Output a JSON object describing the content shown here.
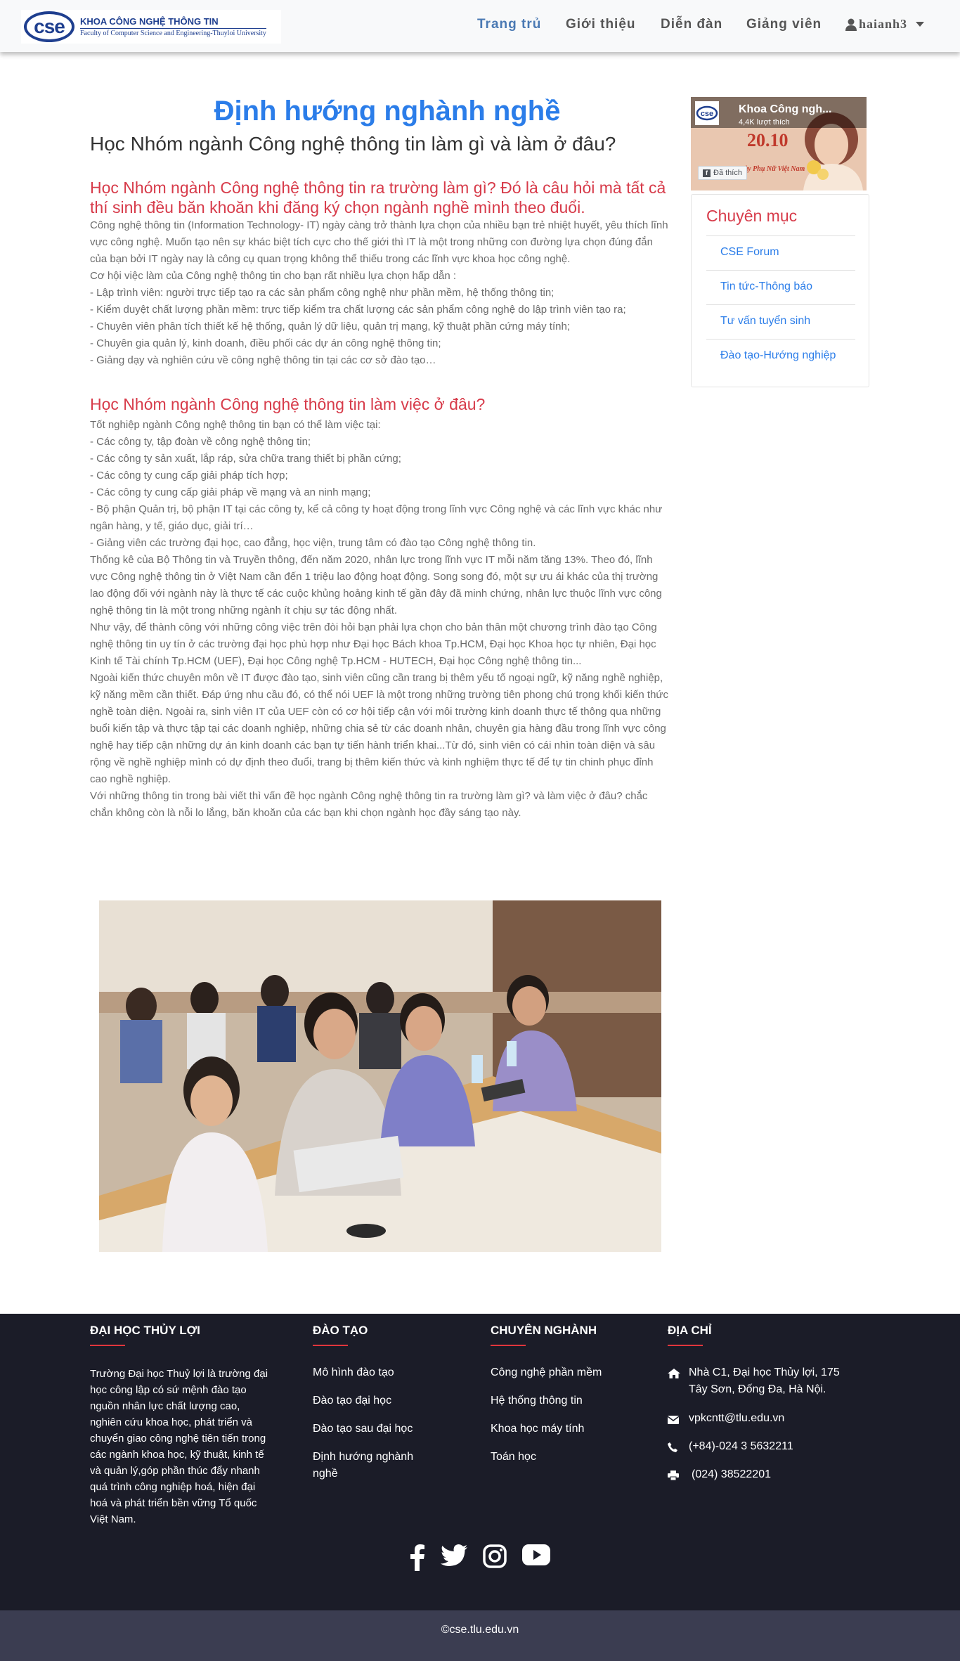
{
  "navbar": {
    "brand_short": "cse",
    "brand_name": "KHOA CÔNG NGHỆ THÔNG TIN",
    "brand_sub": "Faculty of Computer Science and Engineering-Thuyloi University",
    "items": [
      {
        "label": "Trang trủ"
      },
      {
        "label": "Giới thiệu"
      },
      {
        "label": "Diễn đàn"
      },
      {
        "label": "Giảng viên"
      }
    ],
    "user": "haianh3",
    "accent": "#4a79b3"
  },
  "article": {
    "title": "Định hướng nghành nghề",
    "subtitle": "Học Nhóm ngành Công nghệ thông tin làm gì và làm ở đâu?",
    "section1_heading": "Học Nhóm ngành Công nghệ thông tin ra trường làm gì? Đó là câu hỏi mà tất cả thí sinh đều băn khoăn khi đăng ký chọn ngành nghề mình theo đuổi.",
    "section1_paragraphs": [
      "Công nghệ thông tin (Information Technology- IT) ngày càng trở thành lựa chọn của nhiều bạn trẻ nhiệt huyết, yêu thích lĩnh vực công nghệ. Muốn tạo nên sự khác biệt tích cực cho thế giới thì IT là một trong những con đường lựa chọn đúng đắn của bạn bởi IT ngày nay là công cụ quan trọng không thể thiếu trong các lĩnh vực khoa học công nghệ.",
      "Cơ hội việc làm của Công nghệ thông tin cho bạn rất nhiều lựa chọn hấp dẫn :",
      "- Lập trình viên: người trực tiếp tạo ra các sản phẩm công nghệ như phần mềm, hệ thống thông tin;",
      "- Kiểm duyệt chất lượng phần mềm: trực tiếp kiểm tra chất lượng các sản phẩm công nghệ do lập trình viên tạo ra;",
      "- Chuyên viên phân tích thiết kế hệ thống, quản lý dữ liệu, quản trị mạng, kỹ thuật phần cứng máy tính;",
      "- Chuyên gia quản lý, kinh doanh, điều phối các dự án công nghệ thông tin;",
      "- Giảng dạy và nghiên cứu về công nghệ thông tin tại các cơ sở đào tạo…"
    ],
    "section2_heading": "Học Nhóm ngành Công nghệ thông tin làm việc ở đâu?",
    "section2_paragraphs": [
      "Tốt nghiệp ngành Công nghệ thông tin bạn có thể làm việc tại:",
      "- Các công ty, tập đoàn về công nghệ thông tin;",
      "- Các công ty sản xuất, lắp ráp, sửa chữa trang thiết bị phần cứng;",
      "- Các công ty cung cấp giải pháp tích hợp;",
      "- Các công ty cung cấp giải pháp về mạng và an ninh mạng;",
      "- Bộ phận Quản trị, bộ phận IT tại các công ty, kể cả công ty hoạt động trong lĩnh vực Công nghệ và các lĩnh vực khác như ngân hàng, y tế, giáo dục, giải trí…",
      "- Giảng viên các trường đại học, cao đẳng, học viện, trung tâm có đào tạo Công nghệ thông tin.",
      "Thống kê của Bộ Thông tin và Truyền thông, đến năm 2020, nhân lực trong lĩnh vực IT mỗi năm tăng 13%. Theo đó, lĩnh vực Công nghệ thông tin ở Việt Nam cần đến 1 triệu lao động hoạt động. Song song đó, một sự ưu ái khác của thị trường lao động đối với ngành này là thực tế các cuộc khủng hoảng kinh tế gần đây đã minh chứng, nhân lực thuộc lĩnh vực công nghệ thông tin là một trong những ngành ít chịu sự tác động nhất.",
      "Như vậy, để thành công với những công việc trên đòi hỏi bạn phải lựa chọn cho bản thân một chương trình đào tạo Công nghệ thông tin uy tín ở các trường đại học phù hợp như Đại học Bách khoa Tp.HCM, Đại học Khoa học tự nhiên, Đại học Kinh tế Tài chính Tp.HCM (UEF), Đại học Công nghệ Tp.HCM - HUTECH, Đại học Công nghệ thông tin...",
      "Ngoài kiến thức chuyên môn về IT được đào tạo, sinh viên cũng cần trang bị thêm yếu tố ngoại ngữ, kỹ năng nghề nghiệp, kỹ năng mềm cần thiết. Đáp ứng nhu cầu đó, có thể nói UEF là một trong những trường tiên phong chú trọng khối kiến thức nghề toàn diện. Ngoài ra, sinh viên IT của UEF còn có cơ hội tiếp cận với môi trường kinh doanh thực tế thông qua những buổi kiến tập và thực tập tại các doanh nghiệp, những chia sẻ từ các doanh nhân, chuyên gia hàng đầu trong lĩnh vực công nghệ hay tiếp cận những dự án kinh doanh các bạn tự tiến hành triển khai...Từ đó, sinh viên có cái nhìn toàn diện và sâu rộng về nghề nghiệp mình có dự định theo đuổi, trang bị thêm kiến thức và kinh nghiệm thực tế để tự tin chinh phục đỉnh cao nghề nghiệp.",
      "Với những thông tin trong bài viết thì vấn đề học ngành Công nghệ thông tin ra trường làm gì? và làm việc ở đâu? chắc chắn không còn là nỗi lo lắng, băn khoăn của các bạn khi chọn ngành học đầy sáng tạo này."
    ]
  },
  "sidebar": {
    "fb_page_name": "Khoa Công ngh...",
    "fb_likes": "4,4K lượt thích",
    "fb_like_button": "Đã thích",
    "fb_banner_number": "20.10",
    "fb_banner_caption": "Ngày Phụ Nữ Việt Nam",
    "categories_title": "Chuyên mục",
    "categories": [
      {
        "label": "CSE Forum"
      },
      {
        "label": "Tin tức-Thông báo"
      },
      {
        "label": "Tư vấn tuyển sinh"
      },
      {
        "label": "Đào tạo-Hướng nghiệp"
      }
    ]
  },
  "footer": {
    "col1_title": "ĐẠI HỌC THỦY LỢI",
    "col1_text": "Trường Đại học Thuỷ lợi là trường đại học công lập có sứ mệnh đào tạo nguồn nhân lực chất lượng cao, nghiên cứu khoa học, phát triển và chuyển giao công nghệ tiên tiến trong các ngành khoa học, kỹ thuật, kinh tế và quản lý,góp phần thúc đẩy nhanh quá trình công nghiệp hoá, hiện đại hoá và phát triển bền vững Tổ quốc Việt Nam.",
    "col2_title": "ĐÀO TẠO",
    "col2_links": [
      {
        "label": "Mô hình đào tạo"
      },
      {
        "label": "Đào tạo đại học"
      },
      {
        "label": "Đào tạo sau đại học"
      },
      {
        "label": "Định hướng nghành nghề"
      }
    ],
    "col3_title": "CHUYÊN NGHÀNH",
    "col3_links": [
      {
        "label": "Công nghệ phần mềm"
      },
      {
        "label": "Hệ thống thông tin"
      },
      {
        "label": "Khoa học máy tính"
      },
      {
        "label": "Toán học"
      }
    ],
    "col4_title": "ĐỊA CHỈ",
    "contacts": [
      {
        "icon": "home-icon",
        "text": "Nhà C1, Đại học Thủy lợi, 175 Tây Sơn, Đống Đa, Hà Nội."
      },
      {
        "icon": "envelope-icon",
        "text": "vpkcntt@tlu.edu.vn"
      },
      {
        "icon": "phone-icon",
        "text": "(+84)-024 3 5632211"
      },
      {
        "icon": "print-icon",
        "text": "(024) 38522201"
      }
    ],
    "socials": [
      "facebook-icon",
      "twitter-icon",
      "instagram-icon",
      "youtube-icon"
    ],
    "copyright": "©cse.tlu.edu.vn",
    "accent": "#e2353d"
  }
}
